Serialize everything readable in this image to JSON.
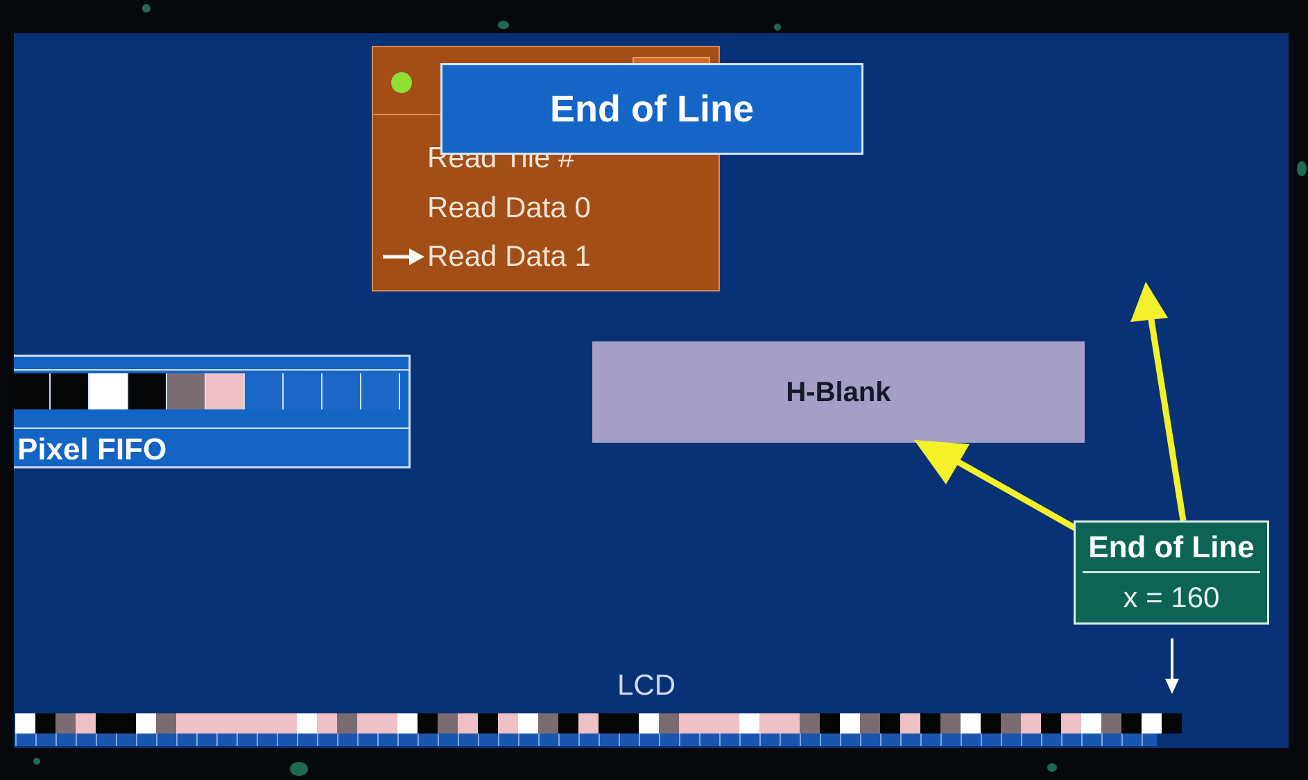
{
  "banner": {
    "title": "End of Line"
  },
  "fetcher": {
    "steps": [
      "Read Tile #",
      "Read Data 0",
      "Read Data 1"
    ],
    "current_step": "Read Data 1"
  },
  "fifo": {
    "label": "Pixel FIFO",
    "cells": [
      "#050607",
      "#050607",
      "#ffffff",
      "#050607",
      "#7a6c72",
      "#efc0c5",
      "#1c66c6",
      "#1c66c6",
      "#1c66c6",
      "#1c66c6"
    ]
  },
  "hblank": {
    "label": "H-Blank"
  },
  "end_of_line": {
    "title": "End of Line",
    "condition": "x = 160"
  },
  "lcd": {
    "label": "LCD",
    "pixels": [
      "#ffffff",
      "#050607",
      "#7a6c72",
      "#efc0c5",
      "#050607",
      "#050607",
      "#ffffff",
      "#7a6c72",
      "#efc0c5",
      "#efc0c5",
      "#efc0c5",
      "#efc0c5",
      "#efc0c5",
      "#efc0c5",
      "#ffffff",
      "#efc0c5",
      "#7a6c72",
      "#efc0c5",
      "#efc0c5",
      "#ffffff",
      "#050607",
      "#7a6c72",
      "#efc0c5",
      "#050607",
      "#efc0c5",
      "#ffffff",
      "#7a6c72",
      "#050607",
      "#efc0c5",
      "#050607",
      "#050607",
      "#ffffff",
      "#7a6c72",
      "#efc0c5",
      "#efc0c5",
      "#efc0c5",
      "#ffffff",
      "#efc0c5",
      "#efc0c5",
      "#7a6c72",
      "#050607",
      "#ffffff",
      "#7a6c72",
      "#050607",
      "#efc0c5",
      "#050607",
      "#7a6c72",
      "#ffffff",
      "#050607",
      "#7a6c72",
      "#efc0c5",
      "#050607",
      "#efc0c5",
      "#ffffff",
      "#7a6c72",
      "#050607",
      "#ffffff",
      "#050607"
    ]
  },
  "colors": {
    "background": "#083176",
    "fetcher": "#a34e16",
    "banner": "#1565c6",
    "hblank": "#a59fc5",
    "end_of_line_box": "#0d6455",
    "arrow": "#f4f02a"
  }
}
